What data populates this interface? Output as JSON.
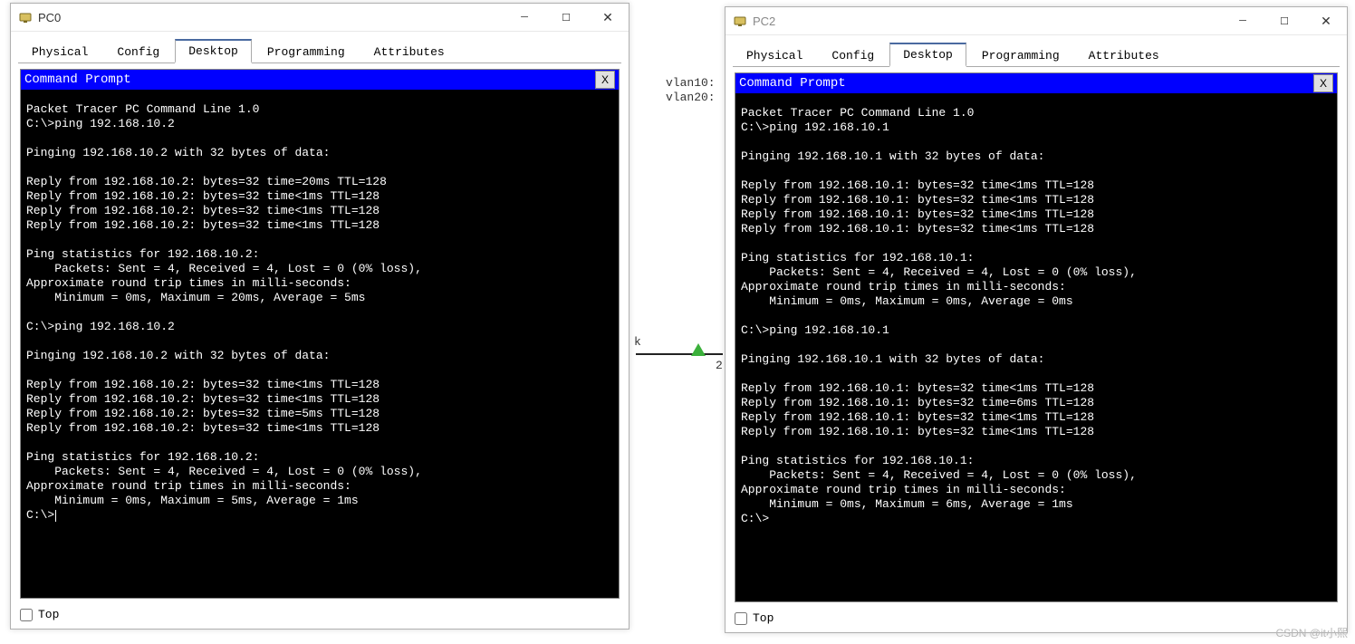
{
  "background": {
    "vlan10_label": "vlan10:",
    "vlan20_label": "vlan20:",
    "side_char_upper": "k",
    "side_char_lower": "2",
    "watermark": "CSDN @it小熙"
  },
  "windows": [
    {
      "id": "pc0",
      "title": "PC0",
      "active_tab": 2,
      "tabs": [
        "Physical",
        "Config",
        "Desktop",
        "Programming",
        "Attributes"
      ],
      "terminal_title": "Command Prompt",
      "terminal_close": "X",
      "footer_label": "Top",
      "output": "Packet Tracer PC Command Line 1.0\nC:\\>ping 192.168.10.2\n\nPinging 192.168.10.2 with 32 bytes of data:\n\nReply from 192.168.10.2: bytes=32 time=20ms TTL=128\nReply from 192.168.10.2: bytes=32 time<1ms TTL=128\nReply from 192.168.10.2: bytes=32 time<1ms TTL=128\nReply from 192.168.10.2: bytes=32 time<1ms TTL=128\n\nPing statistics for 192.168.10.2:\n    Packets: Sent = 4, Received = 4, Lost = 0 (0% loss),\nApproximate round trip times in milli-seconds:\n    Minimum = 0ms, Maximum = 20ms, Average = 5ms\n\nC:\\>ping 192.168.10.2\n\nPinging 192.168.10.2 with 32 bytes of data:\n\nReply from 192.168.10.2: bytes=32 time<1ms TTL=128\nReply from 192.168.10.2: bytes=32 time<1ms TTL=128\nReply from 192.168.10.2: bytes=32 time=5ms TTL=128\nReply from 192.168.10.2: bytes=32 time<1ms TTL=128\n\nPing statistics for 192.168.10.2:\n    Packets: Sent = 4, Received = 4, Lost = 0 (0% loss),\nApproximate round trip times in milli-seconds:\n    Minimum = 0ms, Maximum = 5ms, Average = 1ms\n",
      "prompt_final": "C:\\>"
    },
    {
      "id": "pc2",
      "title": "PC2",
      "active_tab": 2,
      "tabs": [
        "Physical",
        "Config",
        "Desktop",
        "Programming",
        "Attributes"
      ],
      "terminal_title": "Command Prompt",
      "terminal_close": "X",
      "footer_label": "Top",
      "output": "Packet Tracer PC Command Line 1.0\nC:\\>ping 192.168.10.1\n\nPinging 192.168.10.1 with 32 bytes of data:\n\nReply from 192.168.10.1: bytes=32 time<1ms TTL=128\nReply from 192.168.10.1: bytes=32 time<1ms TTL=128\nReply from 192.168.10.1: bytes=32 time<1ms TTL=128\nReply from 192.168.10.1: bytes=32 time<1ms TTL=128\n\nPing statistics for 192.168.10.1:\n    Packets: Sent = 4, Received = 4, Lost = 0 (0% loss),\nApproximate round trip times in milli-seconds:\n    Minimum = 0ms, Maximum = 0ms, Average = 0ms\n\nC:\\>ping 192.168.10.1\n\nPinging 192.168.10.1 with 32 bytes of data:\n\nReply from 192.168.10.1: bytes=32 time<1ms TTL=128\nReply from 192.168.10.1: bytes=32 time=6ms TTL=128\nReply from 192.168.10.1: bytes=32 time<1ms TTL=128\nReply from 192.168.10.1: bytes=32 time<1ms TTL=128\n\nPing statistics for 192.168.10.1:\n    Packets: Sent = 4, Received = 4, Lost = 0 (0% loss),\nApproximate round trip times in milli-seconds:\n    Minimum = 0ms, Maximum = 6ms, Average = 1ms\n",
      "prompt_final": "C:\\>"
    }
  ]
}
